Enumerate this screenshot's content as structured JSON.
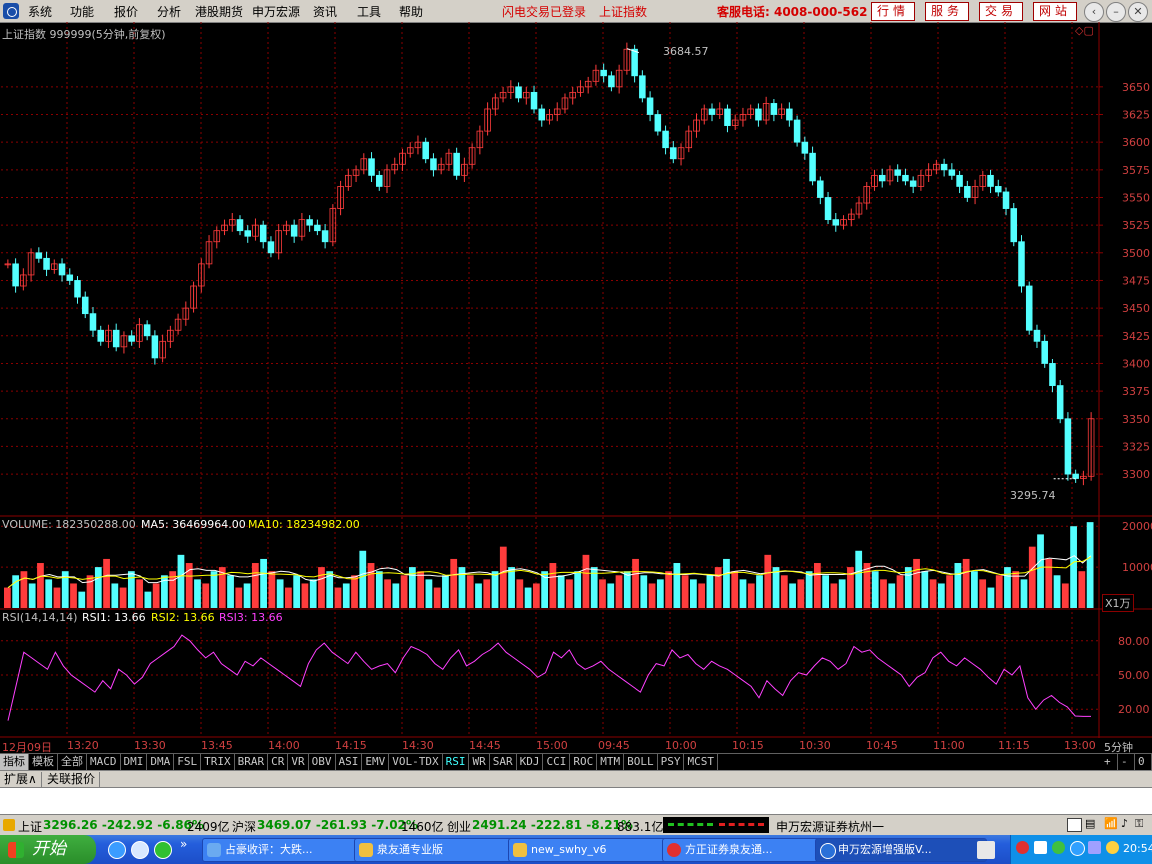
{
  "menu": {
    "items": [
      "系统",
      "功能",
      "报价",
      "分析",
      "港股期货",
      "申万宏源",
      "资讯",
      "工具",
      "帮助"
    ],
    "flash_status": "闪电交易已登录",
    "current_index": "上证指数",
    "hotline": "客服电话: 4008-000-562",
    "service_buttons": [
      "行情",
      "服务",
      "交易",
      "网站"
    ]
  },
  "chart_header": "上证指数 999999(5分钟,前复权)",
  "price": {
    "high_label": "3684.57",
    "low_label": "3295.74",
    "high": 3684.57,
    "low": 3295.74,
    "ymin": 3282,
    "ymax": 3705,
    "ticks": [
      "3650",
      "3625",
      "3600",
      "3575",
      "3550",
      "3525",
      "3500",
      "3475",
      "3450",
      "3425",
      "3400",
      "3375",
      "3350",
      "3325",
      "3300"
    ],
    "tick_values": [
      3650,
      3625,
      3600,
      3575,
      3550,
      3525,
      3500,
      3475,
      3450,
      3425,
      3400,
      3375,
      3350,
      3325,
      3300
    ],
    "path": [
      3490,
      3470,
      3480,
      3500,
      3495,
      3485,
      3490,
      3480,
      3475,
      3460,
      3445,
      3430,
      3420,
      3430,
      3415,
      3425,
      3420,
      3435,
      3425,
      3405,
      3420,
      3430,
      3440,
      3450,
      3470,
      3490,
      3510,
      3520,
      3525,
      3530,
      3520,
      3515,
      3525,
      3510,
      3500,
      3520,
      3525,
      3515,
      3530,
      3525,
      3520,
      3510,
      3540,
      3560,
      3570,
      3575,
      3585,
      3570,
      3560,
      3575,
      3580,
      3590,
      3595,
      3600,
      3585,
      3575,
      3580,
      3590,
      3570,
      3580,
      3595,
      3610,
      3630,
      3640,
      3645,
      3650,
      3640,
      3645,
      3630,
      3620,
      3625,
      3630,
      3640,
      3645,
      3650,
      3655,
      3665,
      3660,
      3650,
      3665,
      3684,
      3660,
      3640,
      3625,
      3610,
      3595,
      3585,
      3595,
      3610,
      3620,
      3630,
      3625,
      3630,
      3615,
      3620,
      3625,
      3630,
      3620,
      3635,
      3625,
      3630,
      3620,
      3600,
      3590,
      3565,
      3550,
      3530,
      3525,
      3530,
      3535,
      3545,
      3560,
      3570,
      3565,
      3575,
      3570,
      3565,
      3560,
      3570,
      3575,
      3580,
      3575,
      3570,
      3560,
      3550,
      3560,
      3570,
      3560,
      3555,
      3540,
      3510,
      3470,
      3430,
      3420,
      3400,
      3380,
      3350,
      3300,
      3296,
      3298,
      3350
    ]
  },
  "volume": {
    "header_label": "VOLUME: 182350288.00",
    "ma5_label": "MA5: 36469964.00",
    "ma10_label": "MA10: 18234982.00",
    "ticks": [
      "20000",
      "10000"
    ],
    "tick_values": [
      20000,
      10000
    ],
    "ymax": 22500,
    "unit": "X1万",
    "bars": [
      5000,
      8000,
      9000,
      6000,
      11000,
      7000,
      5000,
      9000,
      6000,
      4000,
      8000,
      10000,
      12000,
      6000,
      5000,
      9000,
      7000,
      4000,
      6000,
      8000,
      9000,
      13000,
      11000,
      7000,
      6000,
      9000,
      10000,
      8000,
      5000,
      6000,
      11000,
      12000,
      9000,
      7000,
      5000,
      8000,
      6000,
      7000,
      10000,
      9000,
      5000,
      6000,
      8000,
      14000,
      11000,
      9000,
      7000,
      6000,
      8000,
      10000,
      9000,
      7000,
      5000,
      8000,
      12000,
      10000,
      8000,
      6000,
      7000,
      9000,
      15000,
      10000,
      7000,
      5000,
      6000,
      9000,
      11000,
      8000,
      7000,
      9000,
      13000,
      10000,
      7000,
      6000,
      8000,
      9000,
      12000,
      8000,
      6000,
      7000,
      9000,
      11000,
      8000,
      7000,
      6000,
      8000,
      10000,
      12000,
      9000,
      7000,
      6000,
      8000,
      13000,
      10000,
      8000,
      6000,
      7000,
      9000,
      11000,
      8000,
      6000,
      7000,
      10000,
      14000,
      11000,
      9000,
      7000,
      6000,
      8000,
      10000,
      12000,
      9000,
      7000,
      6000,
      8000,
      11000,
      12000,
      9000,
      7000,
      5000,
      8000,
      10000,
      9000,
      7000,
      15000,
      18000,
      12000,
      8000,
      6000,
      20000,
      9000,
      21000
    ]
  },
  "rsi": {
    "header_label": "RSI(14,14,14)",
    "rsi1_label": "RSI1: 13.66",
    "rsi2_label": "RSI2: 13.66",
    "rsi3_label": "RSI3: 13.66",
    "ticks": [
      "80.00",
      "50.00",
      "20.00"
    ],
    "tick_values": [
      80,
      50,
      20
    ],
    "ymin": 0,
    "ymax": 100,
    "path": [
      10,
      40,
      70,
      65,
      60,
      55,
      70,
      58,
      50,
      45,
      40,
      35,
      45,
      38,
      55,
      50,
      42,
      48,
      60,
      65,
      70,
      75,
      85,
      80,
      72,
      65,
      70,
      60,
      55,
      50,
      62,
      58,
      65,
      60,
      55,
      50,
      45,
      40,
      60,
      72,
      78,
      70,
      65,
      60,
      70,
      62,
      55,
      58,
      60,
      52,
      65,
      75,
      72,
      68,
      60,
      55,
      65,
      72,
      58,
      62,
      68,
      72,
      78,
      70,
      65,
      60,
      55,
      48,
      52,
      70,
      65,
      72,
      60,
      55,
      58,
      62,
      55,
      50,
      45,
      40,
      35,
      50,
      60,
      58,
      72,
      65,
      68,
      60,
      55,
      62,
      58,
      55,
      50,
      45,
      40,
      30,
      45,
      38,
      32,
      45,
      52,
      50,
      58,
      65,
      62,
      55,
      60,
      75,
      70,
      72,
      65,
      60,
      55,
      50,
      40,
      48,
      52,
      65,
      70,
      62,
      58,
      65,
      60,
      55,
      48,
      42,
      55,
      50,
      58,
      30,
      20,
      28,
      32,
      26,
      22,
      14,
      13.66,
      13.66
    ]
  },
  "time_axis": {
    "labels": [
      "12月09日",
      "13:20",
      "13:30",
      "13:45",
      "14:00",
      "14:15",
      "14:30",
      "14:45",
      "15:00",
      "09:45",
      "10:00",
      "10:15",
      "10:30",
      "10:45",
      "11:00",
      "11:15",
      "13:00"
    ],
    "period": "5分钟"
  },
  "indicator_tabs": [
    "指标",
    "模板",
    "全部",
    "MACD",
    "DMI",
    "DMA",
    "FSL",
    "TRIX",
    "BRAR",
    "CR",
    "VR",
    "OBV",
    "ASI",
    "EMV",
    "VOL-TDX",
    "RSI",
    "WR",
    "SAR",
    "KDJ",
    "CCI",
    "ROC",
    "MTM",
    "BOLL",
    "PSY",
    "MCST"
  ],
  "active_indicator": "RSI",
  "nav_symbols": [
    "+",
    "-",
    "0"
  ],
  "ext_tabs": [
    "扩展∧",
    "关联报价"
  ],
  "status": {
    "sh_label": "上证",
    "sh_values": "3296.26 -242.92 -6.86%",
    "sh_amount": "2409亿",
    "hs_label": "沪深",
    "hs_values": "3469.07 -261.93 -7.02%",
    "hs_amount": "1460亿",
    "cy_label": "创业",
    "cy_values": "2491.24 -222.81 -8.21%",
    "cy_amount": "883.1亿",
    "broker": "申万宏源证券杭州一"
  },
  "taskbar": {
    "start": "开始",
    "tasks": [
      "占豪收评：大跌...",
      "泉友通专业版",
      "new_swhy_v6",
      "方正证券泉友通...",
      "申万宏源增强版V..."
    ],
    "clock": "20:54"
  },
  "colors": {
    "up": "#ff3c3c",
    "down": "#54ffff",
    "grid": "#8b0000",
    "ma5": "#ffffff",
    "ma10": "#ffff00",
    "rsi": "#ff40ff"
  }
}
